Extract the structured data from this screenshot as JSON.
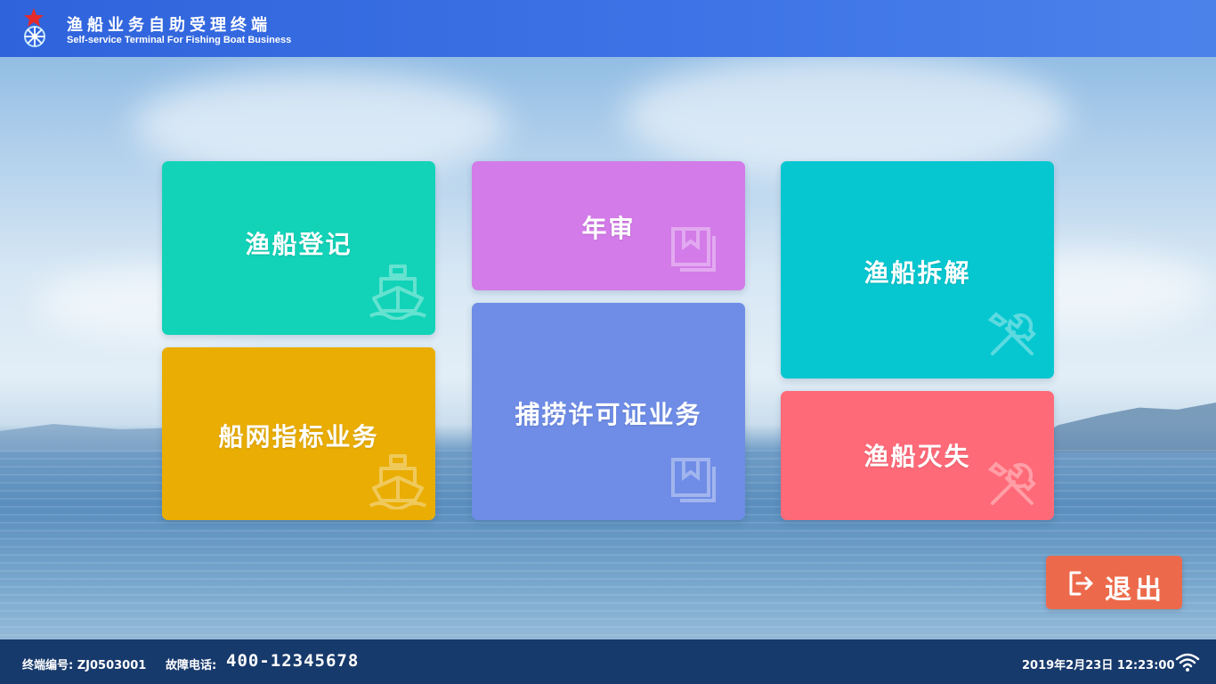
{
  "header": {
    "title_cn": "渔船业务自助受理终端",
    "title_en": "Self-service Terminal For Fishing Boat Business",
    "logo_icon": "emblem-star-snowflake-icon"
  },
  "tiles": [
    {
      "label": "渔船登记",
      "color": "#12d3b8",
      "icon": "ship-icon"
    },
    {
      "label": "船网指标业务",
      "color": "#e9ad03",
      "icon": "ship-icon"
    },
    {
      "label": "年审",
      "color": "#d37be8",
      "icon": "book-icon"
    },
    {
      "label": "捕捞许可证业务",
      "color": "#6f8de6",
      "icon": "book-icon"
    },
    {
      "label": "渔船拆解",
      "color": "#06c7d0",
      "icon": "tools-icon"
    },
    {
      "label": "渔船灭失",
      "color": "#ff6a78",
      "icon": "tools-icon"
    }
  ],
  "exit": {
    "label": "退出",
    "color": "#ec6a4b",
    "icon": "logout-icon"
  },
  "footer": {
    "terminal_label": "终端编号: ZJ0503001",
    "phone_label": "故障电话:",
    "phone_number": "400-12345678",
    "datetime": "2019年2月23日  12:23:00",
    "wifi_icon": "wifi-icon",
    "bg_color": "#173a6c"
  }
}
